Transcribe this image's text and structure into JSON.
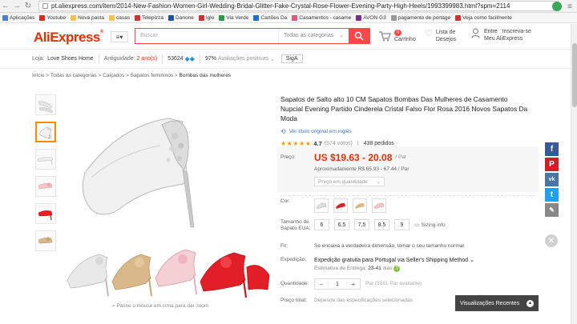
{
  "browser": {
    "url": "pt.aliexpress.com/item/2014-New-Fashion-Women-Girl-Wedding-Bridal-Glitter-Fake-Crystal-Rose-Flower-Evening-Party-High-Heels/1993399983.html?spm=2114"
  },
  "bookmarks": [
    {
      "label": "Aplicações",
      "color": "#4a7cd8"
    },
    {
      "label": "Youtube",
      "color": "#e02a1f"
    },
    {
      "label": "Nova pasta",
      "color": "#f2c14e"
    },
    {
      "label": "casas",
      "color": "#f2c14e"
    },
    {
      "label": "Telepizza",
      "color": "#d32f2f"
    },
    {
      "label": "Danone",
      "color": "#1e4fa8"
    },
    {
      "label": "Iglo",
      "color": "#d32f2f"
    },
    {
      "label": "Via Verde",
      "color": "#2e9b45"
    },
    {
      "label": "Cartões Da",
      "color": "#1e6fd0"
    },
    {
      "label": "Casamentos - casame",
      "color": "#e05a7a"
    },
    {
      "label": "AVON G3",
      "color": "#7a2b8c"
    },
    {
      "label": "pagamento de portage",
      "color": "#999999"
    },
    {
      "label": "Veja como facilmente",
      "color": "#d32f2f"
    }
  ],
  "header": {
    "logo": "AliExpress",
    "search_placeholder": "Buscar",
    "search_category": "Todas as categorias",
    "cart_count": "0",
    "cart_label": "Carrinho",
    "wish_line1": "Lista de",
    "wish_line2": "Desejos",
    "account_enter": "Entre",
    "account_join": "Inscreva-se",
    "account_line2": "Meu AliExpress"
  },
  "store": {
    "label": "Loja:",
    "name": "Love Shoes Home",
    "age_label": "Antiguidade:",
    "age_value": "2 ano(s)",
    "score": "53624",
    "positive": "97%",
    "positive_label": "Avaliações positivas",
    "follow_btn": "SigA"
  },
  "breadcrumb": {
    "items": [
      "Início",
      "Todas as categorias",
      "Calçados",
      "Sapatos femininos"
    ],
    "current": "Bombas das mulheres"
  },
  "gallery": {
    "hint": "Passe o mouse em cima para dar zoom"
  },
  "product": {
    "title": "Sapatos de Salto alto 10 CM Sapatos Bombas Das Mulheres de Casamento Nupcial Evening Partido Cinderela Cristal Falso Flor Rosa 2016 Novos Sapatos Da Moda",
    "translate_link": "Ver título original em inglês",
    "rating": "4.7",
    "votes": "(574 votos)",
    "orders": "438 pedidos",
    "price_label": "Preço:",
    "price": "US $19.63 - 20.08",
    "price_unit": "/ Par",
    "approx": "Aproximadamente R$ 65.93 - 67.44 / Par",
    "qty_price": "Preço em quantidade",
    "color_label": "Cor:",
    "size_label": "Tamanho de Sapato EUA:",
    "sizes": [
      "6",
      "6.5",
      "7.5",
      "8.5",
      "9"
    ],
    "sizing_info": "Sizing info",
    "fit_label": "Fit:",
    "fit_text": "Se encaixa a verdadeira dimensão, tomar o seu tamanho normal",
    "shipping_label": "Expedição:",
    "shipping_text": "Expedição gratuita para Portugal via Seller's Shipping Method",
    "delivery_label": "Estimativa de Entrega:",
    "delivery_value": "23-41",
    "delivery_unit": "dias",
    "quantity_label": "Quantidade:",
    "quantity": "1",
    "available": "Par (5561 Par available)",
    "total_label": "Preço total:",
    "total_text": "Depende das especificações selecionadas"
  },
  "recent": {
    "label": "Visualizações Recentes"
  },
  "social": [
    "f",
    "P",
    "vk",
    "t",
    "✎"
  ]
}
